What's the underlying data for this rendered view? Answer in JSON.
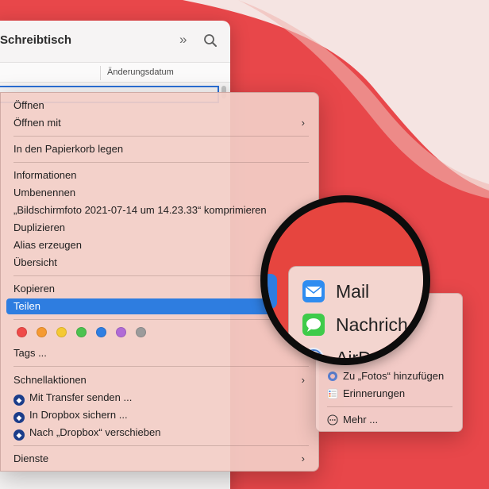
{
  "finder": {
    "title": "Schreibtisch",
    "chevrons": "»",
    "column_date": "Änderungsdatum"
  },
  "menu": {
    "items": [
      {
        "label": "Öffnen"
      },
      {
        "label": "Öffnen mit",
        "arrow": "›"
      },
      {
        "label": "In den Papierkorb legen"
      },
      {
        "label": "Informationen"
      },
      {
        "label": "Umbenennen"
      },
      {
        "label": "„Bildschirmfoto 2021-07-14 um 14.23.33“ komprimieren"
      },
      {
        "label": "Duplizieren"
      },
      {
        "label": "Alias erzeugen"
      },
      {
        "label": "Übersicht"
      },
      {
        "label": "Kopieren"
      },
      {
        "label": "Teilen",
        "selected": true
      },
      {
        "label": "Tags ..."
      },
      {
        "label": "Schnellaktionen",
        "arrow": "›"
      },
      {
        "label": "Mit Transfer senden ..."
      },
      {
        "label": "In Dropbox sichern ..."
      },
      {
        "label": "Nach „Dropbox“ verschieben"
      },
      {
        "label": "Dienste",
        "arrow": "›"
      }
    ],
    "tag_colors": [
      "#ef4a48",
      "#f59a32",
      "#f5c933",
      "#4cc24f",
      "#2f7ee2",
      "#b06bd6",
      "#9b9b9b"
    ]
  },
  "submenu": {
    "items": [
      {
        "label": "Zu „Fotos“ hinzufügen"
      },
      {
        "label": "Erinnerungen"
      },
      {
        "label": "Mehr ..."
      }
    ]
  },
  "magnifier": {
    "items": [
      {
        "label": "Mail",
        "icon": "mail-icon"
      },
      {
        "label": "Nachrich",
        "icon": "messages-icon"
      },
      {
        "label": "AirDro",
        "icon": "airdrop-icon"
      }
    ]
  },
  "colors": {
    "accent": "#2e7de0",
    "wallpaper_red": "#e8474a",
    "wallpaper_pink": "#f6e6e4"
  }
}
